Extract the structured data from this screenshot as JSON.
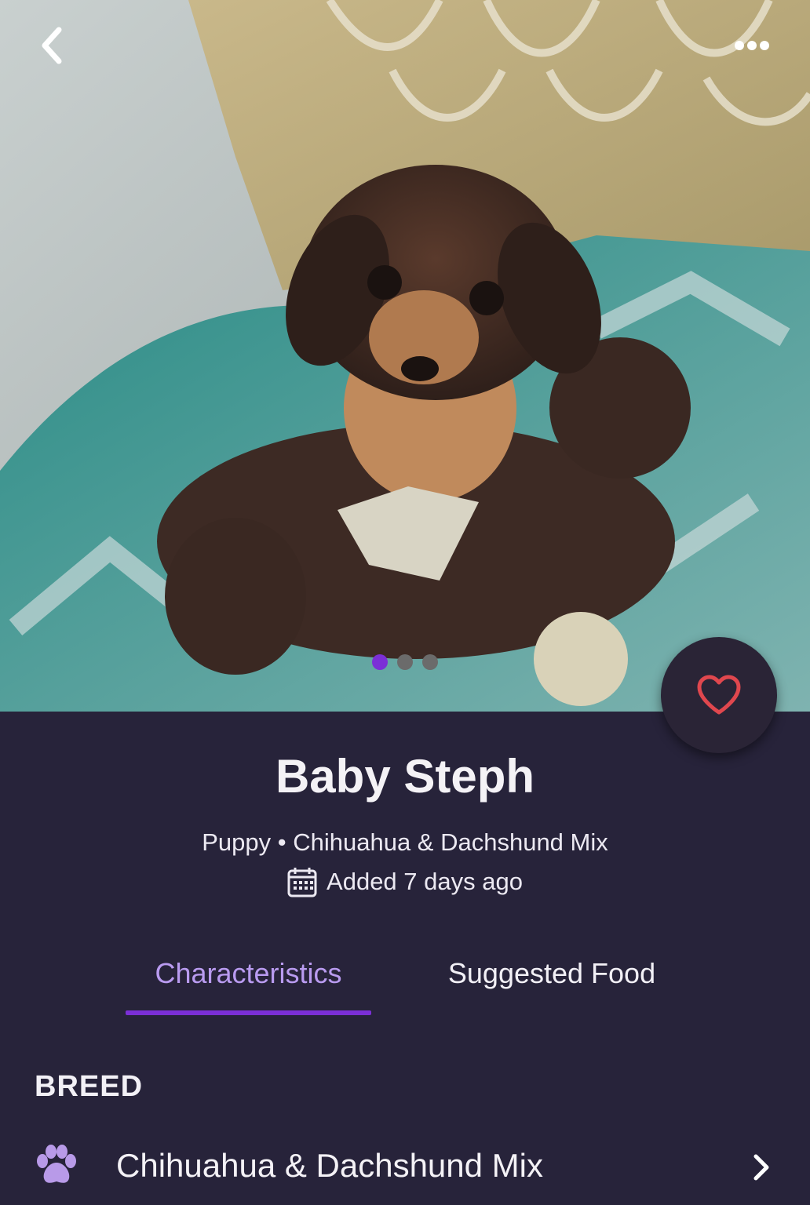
{
  "header": {
    "back_icon": "chevron-left-icon",
    "more_icon": "more-horizontal-icon"
  },
  "photo": {
    "description_hidden": "",
    "carousel": {
      "count": 3,
      "active": 0
    },
    "favorite_icon": "heart-outline-icon",
    "favorite_color": "#e0474e"
  },
  "pet": {
    "name": "Baby Steph",
    "subtitle": "Puppy • Chihuahua & Dachshund Mix",
    "added": "Added 7 days ago",
    "calendar_icon": "calendar-icon"
  },
  "tabs": [
    {
      "label": "Characteristics",
      "active": true
    },
    {
      "label": "Suggested Food",
      "active": false
    }
  ],
  "section": {
    "label": "BREED",
    "item": {
      "icon": "paw-icon",
      "text": "Chihuahua & Dachshund Mix",
      "chevron": "chevron-right-icon"
    }
  },
  "colors": {
    "background": "#27233a",
    "accent": "#7b2fd6",
    "active_tab_text": "#b99bf0",
    "paw": "#b89ae8"
  }
}
